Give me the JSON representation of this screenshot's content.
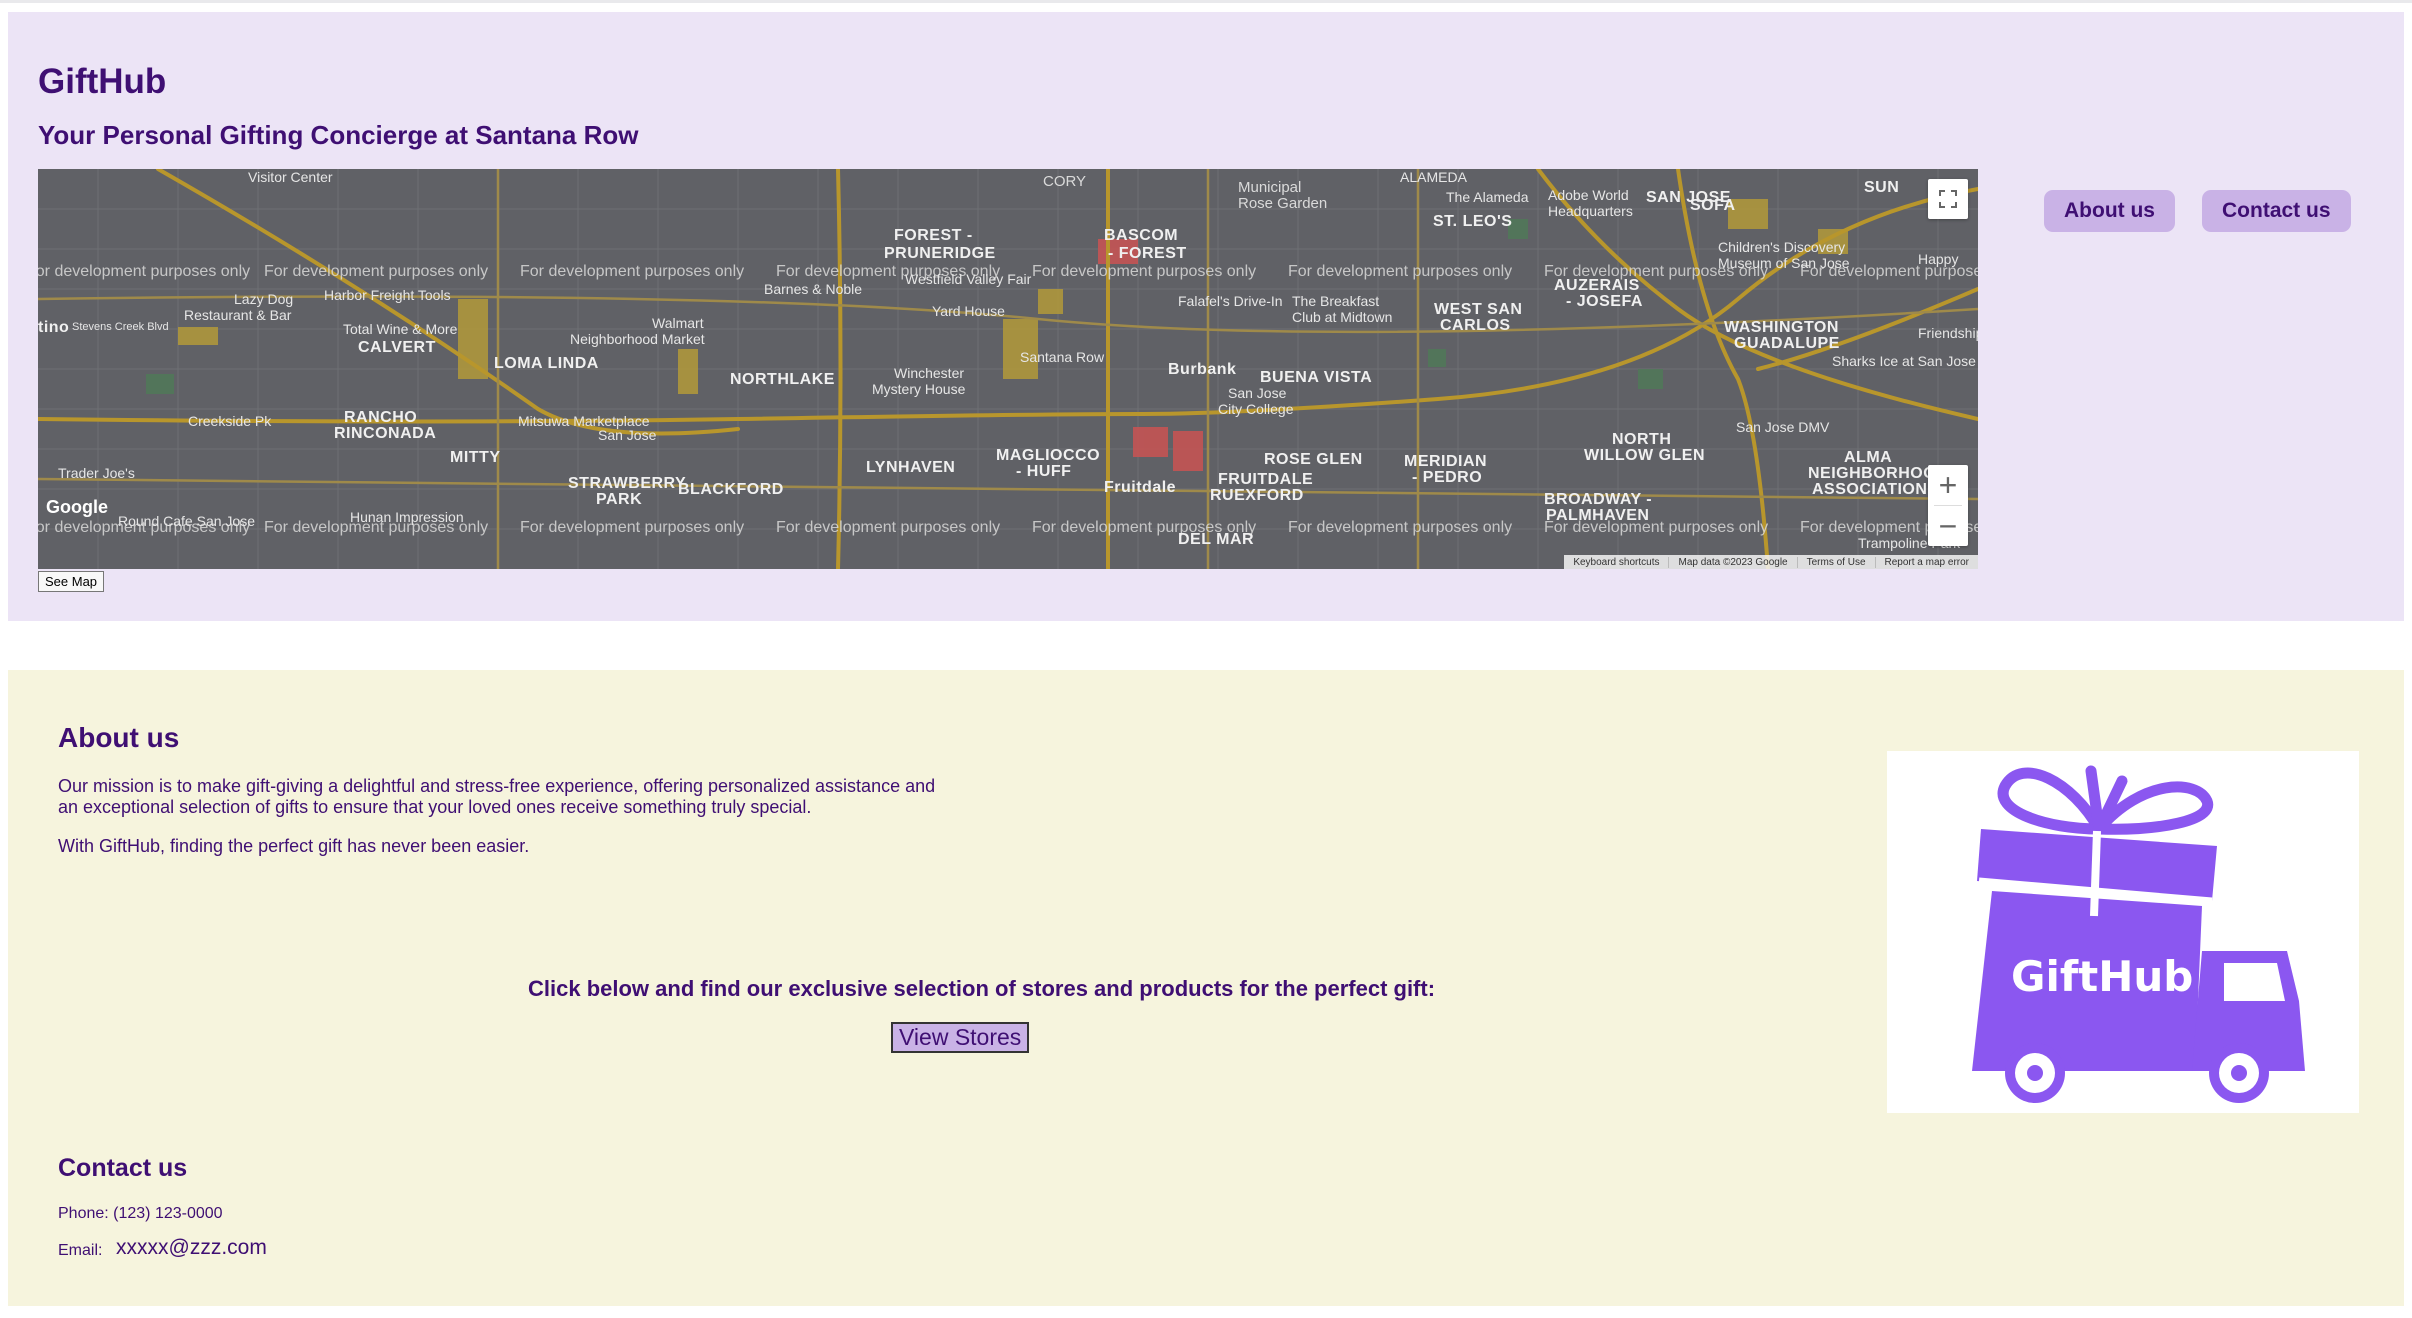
{
  "header": {
    "title": "GiftHub",
    "tagline": "Your Personal Gifting Concierge at Santana Row",
    "nav": {
      "about": "About us",
      "contact": "Contact us"
    }
  },
  "map": {
    "watermark": "For development purposes only",
    "see_map": "See Map",
    "logo_text": "Google",
    "controls": {
      "fullscreen_icon": "fullscreen-icon",
      "zoom_in": "+",
      "zoom_out": "−"
    },
    "attribution": [
      "Keyboard shortcuts",
      "Map data ©2023 Google",
      "Terms of Use",
      "Report a map error"
    ],
    "labels": {
      "cory": "CORY",
      "municipal": "Municipal",
      "rose_garden": "Rose Garden",
      "forest_pruneridge": "FOREST -",
      "pruneridge": "PRUNERIDGE",
      "bascom_forest": "BASCOM",
      "forest": "- FOREST",
      "st_leos": "ST. LEO'S",
      "sofa": "SOFA",
      "sun": "SUN",
      "adobe": "Adobe World",
      "adobe2": "Headquarters",
      "childrens": "Children's Discovery",
      "childrens2": "Museum of San Jose",
      "auzerais": "AUZERAIS",
      "josefa": "- JOSEFA",
      "harbor": "Harbor Freight Tools",
      "lazydog": "Lazy Dog",
      "lazydog2": "Restaurant & Bar",
      "westfield": "Westfield Valley Fair",
      "barnes": "Barnes & Noble",
      "yard": "Yard House",
      "falafel": "Falafel's Drive-In",
      "breakfast": "The Breakfast",
      "breakfast2": "Club at Midtown",
      "west_san": "WEST SAN",
      "carlos": "CARLOS",
      "washington": "WASHINGTON",
      "guadalupe": "GUADALUPE",
      "sharks": "Sharks Ice at San Jose",
      "friendship": "Friendship",
      "cupertino": "tino",
      "stevens": "Stevens Creek Blvd",
      "total_wine": "Total Wine & More",
      "calvert": "CALVERT",
      "walmart": "Walmart",
      "neighborhood": "Neighborhood Market",
      "loma": "LOMA LINDA",
      "northlake": "NORTHLAKE",
      "winchester": "Winchester",
      "mystery": "Mystery House",
      "santana": "Santana Row",
      "burbank": "Burbank",
      "buena": "BUENA VISTA",
      "creekside": "Creekside Pk",
      "rancho": "RANCHO",
      "rinconada": "RINCONADA",
      "mitsuwa": "Mitsuwa Marketplace",
      "mitsuwa2": "San Jose",
      "sjcc": "San Jose",
      "sjcc2": "City College",
      "sjdmv": "San Jose DMV",
      "mitty": "MITTY",
      "lynhaven": "LYNHAVEN",
      "magliocco": "MAGLIOCCO",
      "huff": "- HUFF",
      "rose_glen": "ROSE GLEN",
      "meridian": "MERIDIAN",
      "pedro": "- PEDRO",
      "north_willow": "NORTH",
      "willow_glen": "WILLOW GLEN",
      "alma": "ALMA",
      "alma_n": "NEIGHBORHOOD",
      "alma_a": "ASSOCIATION",
      "trader": "Trader Joe's",
      "strawberry": "STRAWBERRY",
      "park": "PARK",
      "blackford": "BLACKFORD",
      "fruitdale": "Fruitdale",
      "fruitdale_n": "FRUITDALE",
      "ruexford": "RUEXFORD",
      "broadway": "BROADWAY -",
      "palmhaven": "PALMHAVEN",
      "hunan": "Hunan Impression",
      "round": "Round Cafe San Jose",
      "delmar": "DEL MAR",
      "trampoline": "Trampoline Park",
      "happy": "Happy",
      "visitor": "Visitor Center",
      "alameda": "ALAMEDA",
      "the_alameda": "The Alameda",
      "san_jose_top": "SAN JOSE"
    }
  },
  "about": {
    "title": "About us",
    "p1": "Our mission is to make gift-giving a delightful and stress-free experience, offering personalized assistance and an exceptional selection of gifts to ensure that your loved ones receive something truly special.",
    "p2": "With GiftHub, finding the perfect gift has never been easier.",
    "cta": "Click below and find our exclusive selection of stores and products for the perfect gift:",
    "button": "View Stores"
  },
  "logo": {
    "text": "GiftHub",
    "color": "#8b57f0",
    "icon": "gift-truck-icon"
  },
  "contact": {
    "title": "Contact us",
    "phone": "Phone: (123) 123-0000",
    "email_label": "Email:",
    "email": "xxxxx@zzz.com"
  },
  "colors": {
    "header_bg": "#ece4f6",
    "main_bg": "#f6f4dd",
    "text": "#3f0f73",
    "button_bg": "#c9b2e6",
    "map_bg": "#606166",
    "road": "#b8962c"
  }
}
